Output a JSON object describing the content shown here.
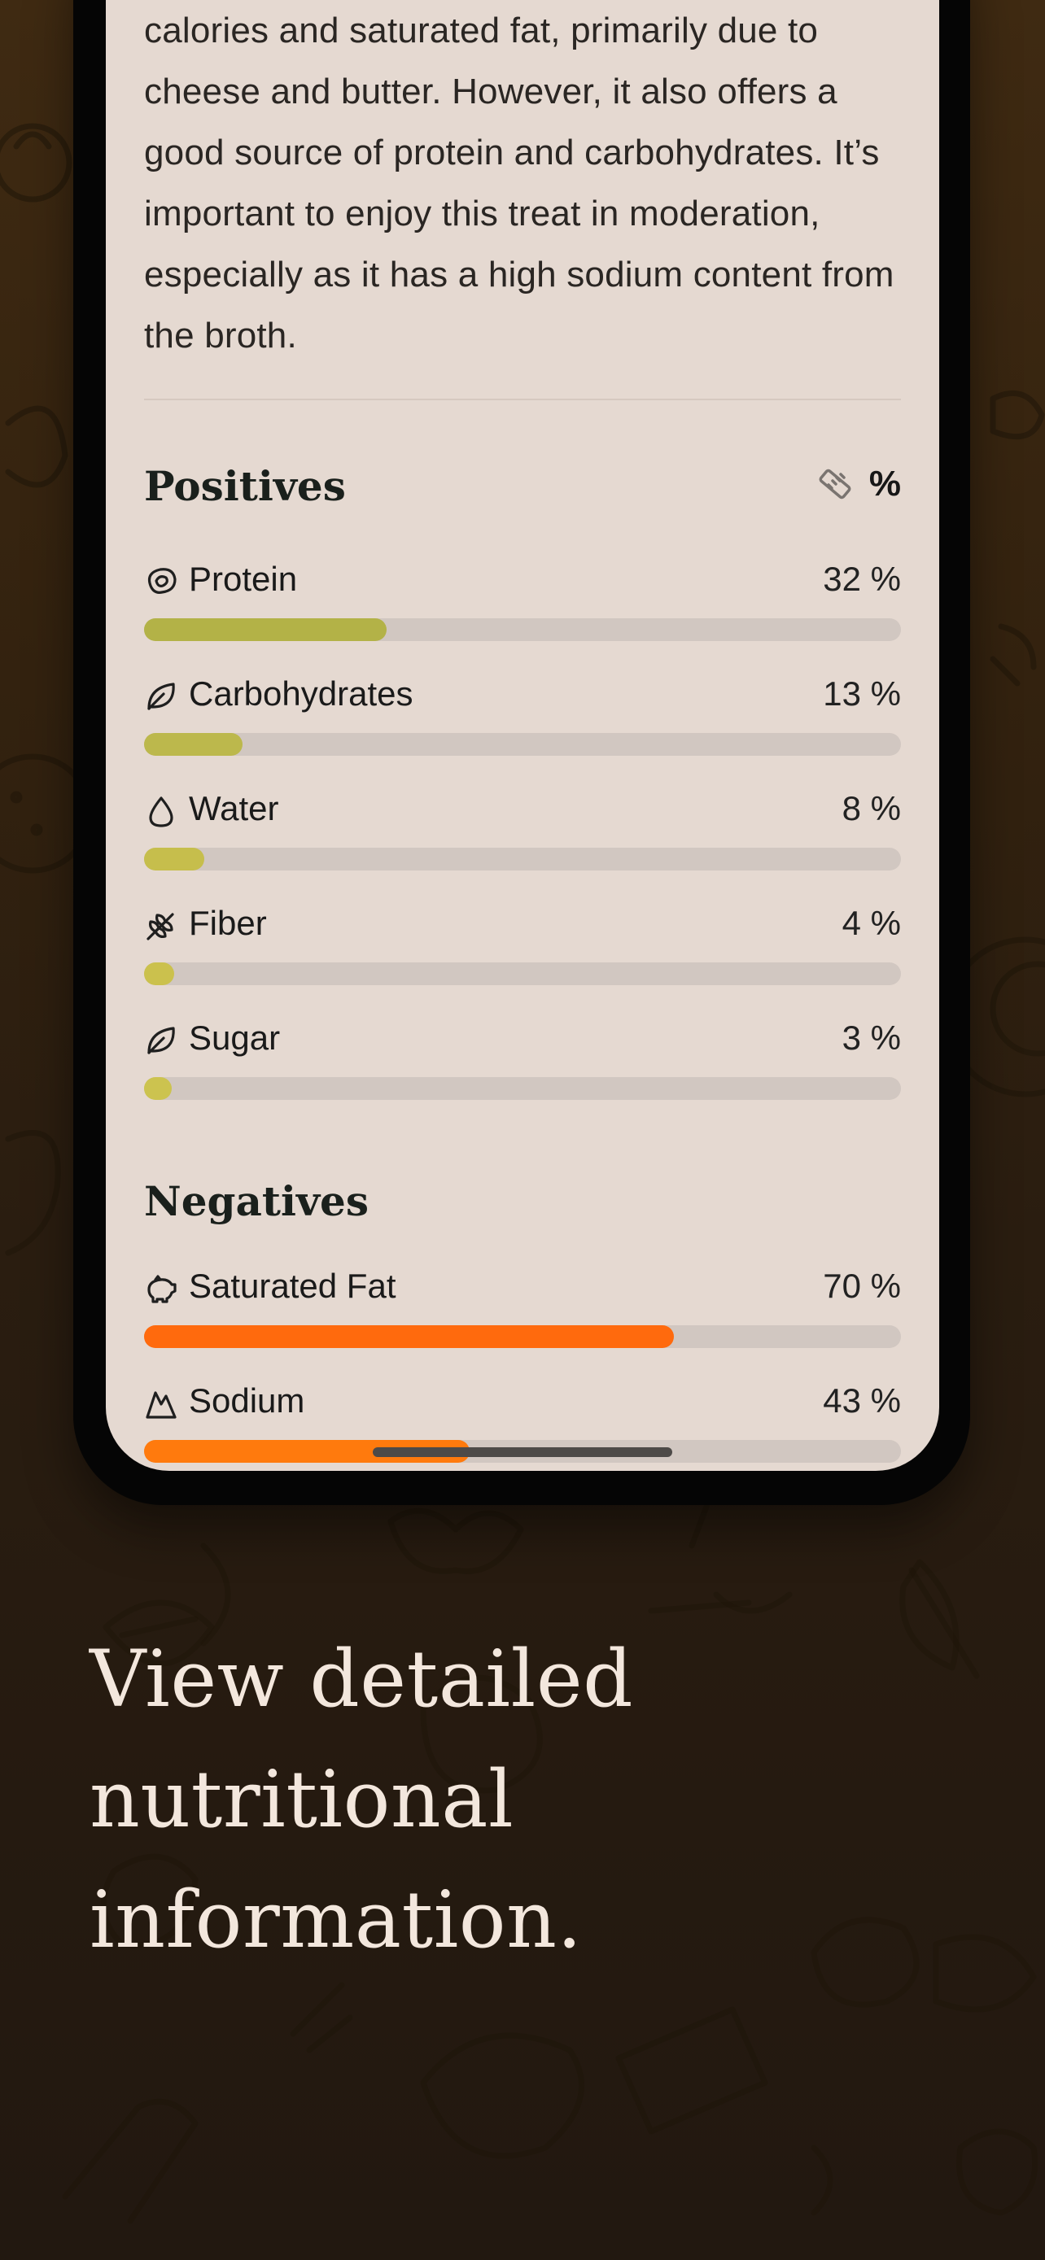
{
  "summary_text": "calories and saturated fat, primarily due to cheese and butter. However, it also offers a good source of protein and carbohydrates. It’s important to enjoy this treat in moderation, especially as it has a high sodium content from the broth.",
  "positives": {
    "title": "Positives",
    "unit_toggle": "%",
    "items": [
      {
        "label": "Protein",
        "value": "32 %",
        "fraction": 0.32,
        "icon": "steak-icon",
        "color": "#b3b247"
      },
      {
        "label": "Carbohydrates",
        "value": "13 %",
        "fraction": 0.13,
        "icon": "leaf-icon",
        "color": "#bcb84c"
      },
      {
        "label": "Water",
        "value": "8 %",
        "fraction": 0.08,
        "icon": "water-drop-icon",
        "color": "#c6be4c"
      },
      {
        "label": "Fiber",
        "value": "4 %",
        "fraction": 0.04,
        "icon": "wheat-icon",
        "color": "#cbc14d"
      },
      {
        "label": "Sugar",
        "value": "3 %",
        "fraction": 0.03,
        "icon": "leaf-icon",
        "color": "#ccc34f"
      }
    ]
  },
  "negatives": {
    "title": "Negatives",
    "items": [
      {
        "label": "Saturated Fat",
        "value": "70 %",
        "fraction": 0.7,
        "icon": "pig-icon",
        "color": "#ff6a0d"
      },
      {
        "label": "Sodium",
        "value": "43 %",
        "fraction": 0.43,
        "icon": "salt-mound-icon",
        "color": "#ff7a0d"
      }
    ]
  },
  "tagline": [
    "View detailed",
    "nutritional",
    "information."
  ]
}
